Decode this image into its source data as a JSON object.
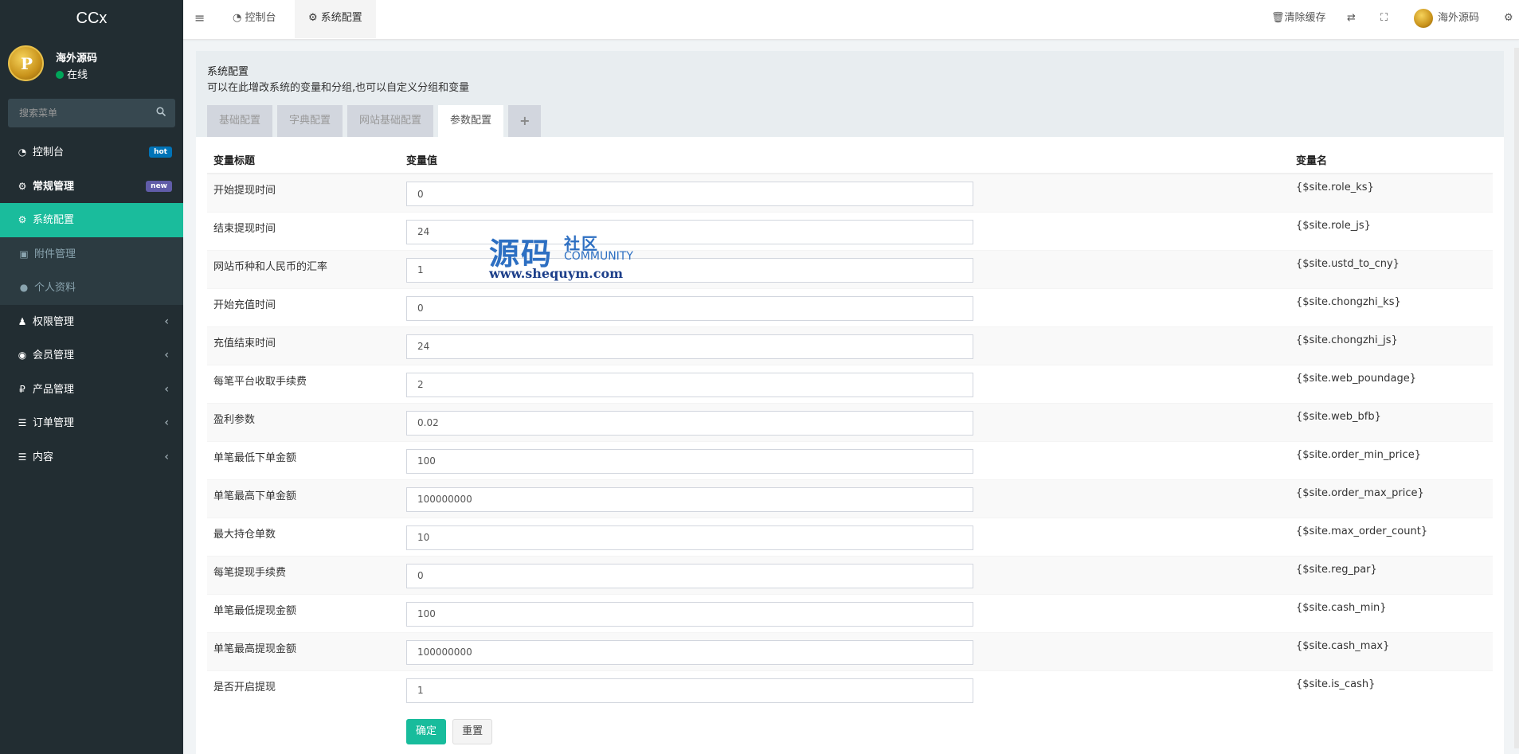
{
  "app": {
    "logo": "CCx"
  },
  "user": {
    "name": "海外源码",
    "status": "在线",
    "avatar_letter": "P"
  },
  "search": {
    "placeholder": "搜索菜单"
  },
  "menu": [
    {
      "label": "控制台",
      "icon": "dashboard-icon",
      "glyph": "◔",
      "badge": "hot",
      "badge_color": "#0073b7"
    },
    {
      "label": "常规管理",
      "icon": "cogs-icon",
      "glyph": "⚙",
      "badge": "new",
      "badge_color": "#605ca8"
    },
    {
      "label": "系统配置",
      "icon": "gear-icon",
      "glyph": "⚙"
    },
    {
      "label": "附件管理",
      "icon": "image-icon",
      "glyph": "▣"
    },
    {
      "label": "个人资料",
      "icon": "user-icon",
      "glyph": "●"
    },
    {
      "label": "权限管理",
      "icon": "group-icon",
      "glyph": "♟"
    },
    {
      "label": "会员管理",
      "icon": "user-circle-icon",
      "glyph": "◉"
    },
    {
      "label": "产品管理",
      "icon": "ruble-icon",
      "glyph": "₽"
    },
    {
      "label": "订单管理",
      "icon": "list-icon",
      "glyph": "☰"
    },
    {
      "label": "内容",
      "icon": "list-icon",
      "glyph": "☰"
    }
  ],
  "header": {
    "tabs": [
      {
        "label": "控制台"
      },
      {
        "label": "系统配置"
      }
    ],
    "clear_cache": "清除缓存",
    "user_name": "海外源码"
  },
  "panel": {
    "title": "系统配置",
    "desc": "可以在此增改系统的变量和分组,也可以自定义分组和变量",
    "tabs": [
      "基础配置",
      "字典配置",
      "网站基础配置",
      "参数配置"
    ],
    "add_tab": "+"
  },
  "table": {
    "headers": [
      "变量标题",
      "变量值",
      "变量名"
    ],
    "rows": [
      {
        "title": "开始提现时间",
        "value": "0",
        "name": "{$site.role_ks}"
      },
      {
        "title": "结束提现时间",
        "value": "24",
        "name": "{$site.role_js}"
      },
      {
        "title": "网站币种和人民币的汇率",
        "value": "1",
        "name": "{$site.ustd_to_cny}"
      },
      {
        "title": "开始充值时间",
        "value": "0",
        "name": "{$site.chongzhi_ks}"
      },
      {
        "title": "充值结束时间",
        "value": "24",
        "name": "{$site.chongzhi_js}"
      },
      {
        "title": "每笔平台收取手续费",
        "value": "2",
        "name": "{$site.web_poundage}"
      },
      {
        "title": "盈利参数",
        "value": "0.02",
        "name": "{$site.web_bfb}"
      },
      {
        "title": "单笔最低下单金额",
        "value": "100",
        "name": "{$site.order_min_price}"
      },
      {
        "title": "单笔最高下单金额",
        "value": "100000000",
        "name": "{$site.order_max_price}"
      },
      {
        "title": "最大持仓单数",
        "value": "10",
        "name": "{$site.max_order_count}"
      },
      {
        "title": "每笔提现手续费",
        "value": "0",
        "name": "{$site.reg_par}"
      },
      {
        "title": "单笔最低提现金额",
        "value": "100",
        "name": "{$site.cash_min}"
      },
      {
        "title": "单笔最高提现金额",
        "value": "100000000",
        "name": "{$site.cash_max}"
      },
      {
        "title": "是否开启提现",
        "value": "1",
        "name": "{$site.is_cash}"
      }
    ]
  },
  "buttons": {
    "confirm": "确定",
    "reset": "重置"
  },
  "watermark": {
    "big": "源码",
    "small": "社区",
    "community": "COMMUNITY",
    "url": "www.shequym.com"
  },
  "colors": {
    "sidebar": "#222d32",
    "accent": "#1abc9c"
  }
}
